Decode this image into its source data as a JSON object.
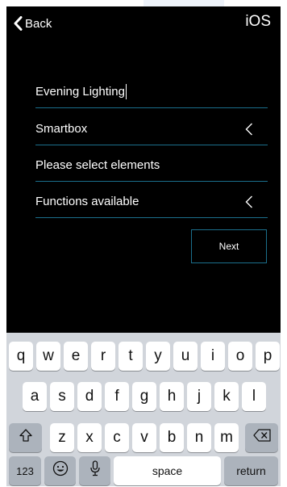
{
  "nav": {
    "back_label": "Back",
    "platform_label": "iOS"
  },
  "form": {
    "name_value": "Evening Lighting",
    "smartbox_label": "Smartbox",
    "select_prompt": "Please select elements",
    "functions_label": "Functions available",
    "next_label": "Next"
  },
  "keyboard": {
    "row1": [
      "q",
      "w",
      "e",
      "r",
      "t",
      "y",
      "u",
      "i",
      "o",
      "p"
    ],
    "row2": [
      "a",
      "s",
      "d",
      "f",
      "g",
      "h",
      "j",
      "k",
      "l"
    ],
    "row3": [
      "z",
      "x",
      "c",
      "v",
      "b",
      "n",
      "m"
    ],
    "numbers_label": "123",
    "space_label": "space",
    "return_label": "return",
    "icons": [
      "shift-icon",
      "backspace-icon",
      "emoji-icon",
      "microphone-icon"
    ]
  },
  "colors": {
    "screen_bg": "#000000",
    "accent_line": "#1b6f8c",
    "keyboard_bg": "#d1d5db",
    "key_bg": "#ffffff",
    "dark_key_bg": "#acb3bc"
  }
}
